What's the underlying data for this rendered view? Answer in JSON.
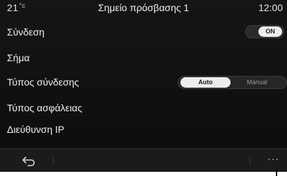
{
  "statusbar": {
    "temperature": "21",
    "temperature_unit": "°c",
    "title": "Σημείο πρόσβασης 1",
    "clock": "12:00"
  },
  "rows": {
    "connection": "Σύνδεση",
    "signal": "Σήμα",
    "connection_type": "Τύπος σύνδεσης",
    "security_type": "Τύπος ασφάλειας",
    "ip_address": "Διεύθυνση IP"
  },
  "connection_toggle": {
    "state_label": "ON",
    "on": true
  },
  "connection_type_options": {
    "selected": "Auto",
    "options": [
      "Auto",
      "Manual"
    ]
  },
  "bottombar": {
    "back_icon": "back-arrow-icon",
    "more_label": "···"
  },
  "colors": {
    "background": "#121213",
    "text": "#f2f2f2",
    "selected_pill": "#ededed"
  }
}
